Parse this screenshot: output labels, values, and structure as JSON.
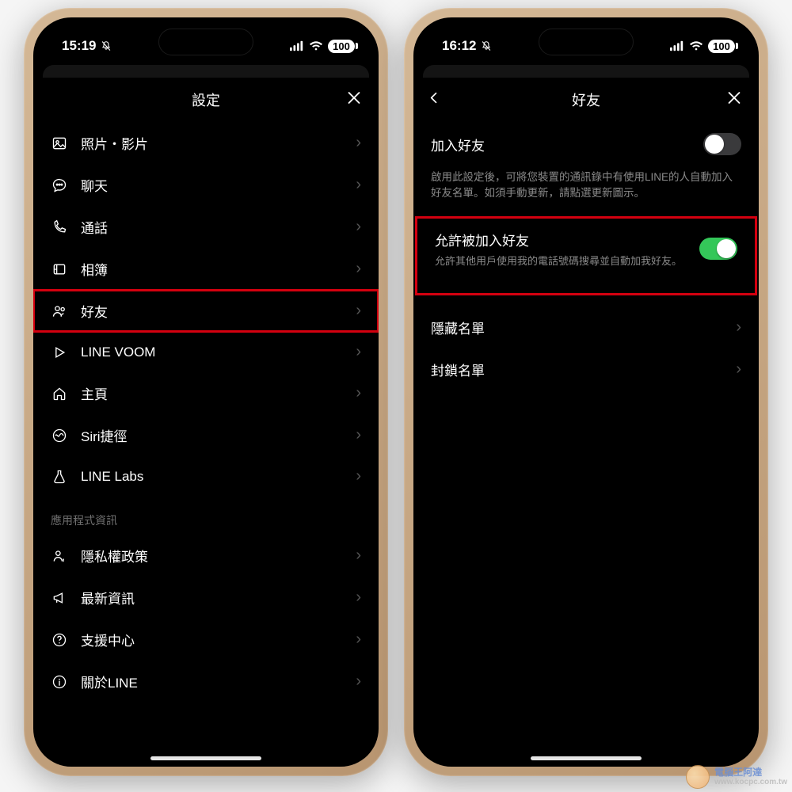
{
  "left": {
    "status": {
      "time": "15:19",
      "battery": "100"
    },
    "nav": {
      "title": "設定"
    },
    "items": [
      {
        "key": "photo-video",
        "label": "照片・影片"
      },
      {
        "key": "chat",
        "label": "聊天"
      },
      {
        "key": "call",
        "label": "通話"
      },
      {
        "key": "album",
        "label": "相簿"
      },
      {
        "key": "friends",
        "label": "好友",
        "highlight": true
      },
      {
        "key": "voom",
        "label": "LINE VOOM"
      },
      {
        "key": "home",
        "label": "主頁"
      },
      {
        "key": "siri",
        "label": "Siri捷徑"
      },
      {
        "key": "labs",
        "label": "LINE Labs"
      }
    ],
    "section_app_info": "應用程式資訊",
    "items2": [
      {
        "key": "privacy",
        "label": "隱私權政策"
      },
      {
        "key": "news",
        "label": "最新資訊"
      },
      {
        "key": "support",
        "label": "支援中心"
      },
      {
        "key": "about",
        "label": "關於LINE"
      }
    ]
  },
  "right": {
    "status": {
      "time": "16:12",
      "battery": "100"
    },
    "nav": {
      "title": "好友"
    },
    "add_friends": {
      "label": "加入好友",
      "desc": "啟用此設定後，可將您裝置的通訊錄中有使用LINE的人自動加入好友名單。如須手動更新，請點選更新圖示。",
      "on": false
    },
    "allow_added": {
      "label": "允許被加入好友",
      "desc": "允許其他用戶使用我的電話號碼搜尋並自動加我好友。",
      "on": true,
      "highlight": true
    },
    "lists": [
      {
        "key": "hidden",
        "label": "隱藏名單"
      },
      {
        "key": "blocked",
        "label": "封鎖名單"
      }
    ]
  },
  "watermark": {
    "line1": "電腦王阿達",
    "line2": "www.kocpc.com.tw"
  }
}
